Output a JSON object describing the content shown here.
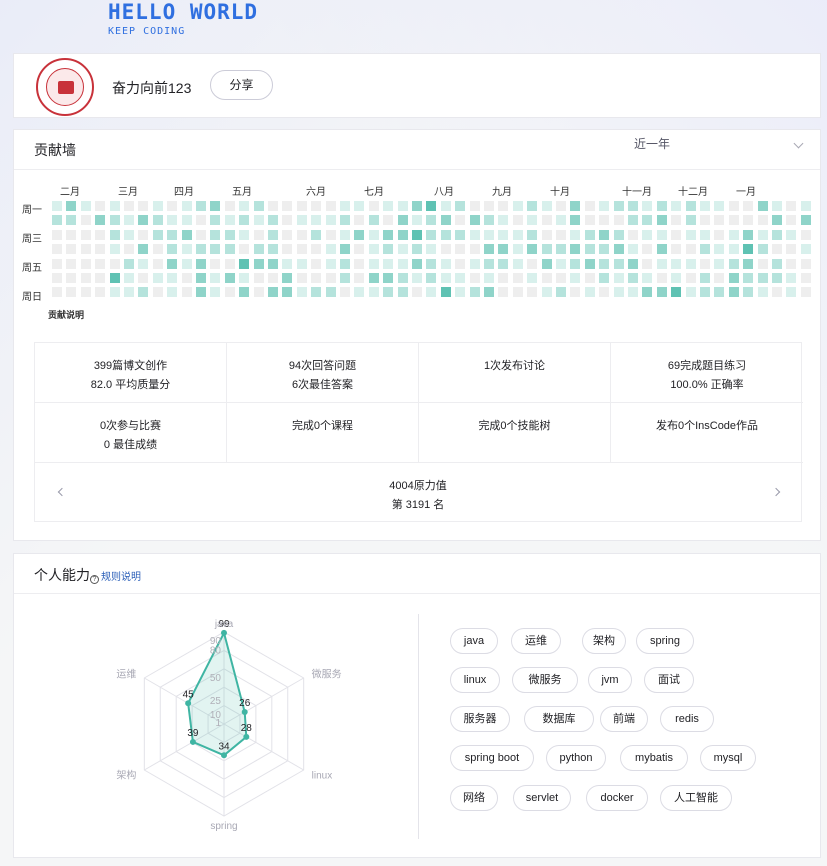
{
  "banner": {
    "title": "HELLO WORLD",
    "subtitle": "KEEP CODING"
  },
  "profile": {
    "nickname": "奋力向前123",
    "share_label": "分享"
  },
  "contrib": {
    "title": "贡献墙",
    "range": "近一年",
    "months": [
      "二月",
      "三月",
      "四月",
      "五月",
      "六月",
      "七月",
      "八月",
      "九月",
      "十月",
      "十一月",
      "十二月",
      "一月"
    ],
    "weekdays": [
      "周一",
      "周三",
      "周五",
      "周日"
    ],
    "legend": "贡献说明",
    "colors": {
      "empty": "#eeeeee",
      "l1": "#d8f0ec",
      "l2": "#b5e3dc",
      "l3": "#8fd4c9",
      "l4": "#5fc2b3"
    }
  },
  "stats": {
    "cells": [
      {
        "l1": "399篇博文创作",
        "l2": "82.0 平均质量分"
      },
      {
        "l1": "94次回答问题",
        "l2": "6次最佳答案"
      },
      {
        "l1": "1次发布讨论",
        "l2": ""
      },
      {
        "l1": "69完成题目练习",
        "l2": "100.0% 正确率"
      },
      {
        "l1": "0次参与比赛",
        "l2": "0 最佳成绩"
      },
      {
        "l1": "完成0个课程",
        "l2": ""
      },
      {
        "l1": "完成0个技能树",
        "l2": ""
      },
      {
        "l1": "发布0个InsCode作品",
        "l2": ""
      }
    ],
    "power_value": "4004原力值",
    "rank": "第 3191 名"
  },
  "ability": {
    "title": "个人能力",
    "rule_link": "规则说明",
    "radar": {
      "axes": [
        "java",
        "微服务",
        "linux",
        "spring",
        "架构",
        "运维"
      ],
      "values": [
        99,
        26,
        28,
        34,
        39,
        45
      ],
      "value_labels": [
        "99",
        "26",
        "28",
        "34",
        "39",
        "45"
      ],
      "scale_ticks": [
        "1",
        "10",
        "25",
        "50",
        "80",
        "90"
      ],
      "max": 100,
      "color": "#3fb5a3"
    },
    "tags": [
      "java",
      "运维",
      "架构",
      "spring",
      "linux",
      "微服务",
      "jvm",
      "面试",
      "服务器",
      "数据库",
      "前端",
      "redis",
      "spring boot",
      "python",
      "mybatis",
      "mysql",
      "网络",
      "servlet",
      "docker",
      "人工智能"
    ]
  }
}
